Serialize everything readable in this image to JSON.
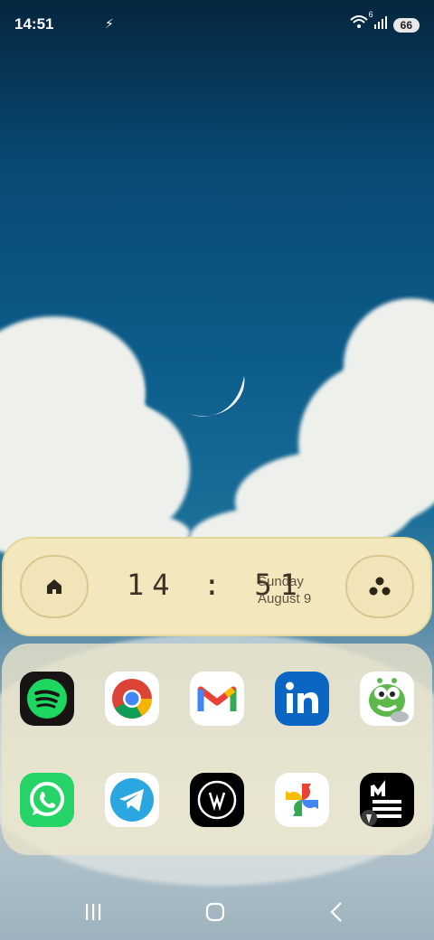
{
  "status_bar": {
    "time": "14:51",
    "signal_tag": "6",
    "battery": "66"
  },
  "icons": [
    "flash-icon",
    "wifi-icon",
    "signal-icon",
    "battery-icon"
  ],
  "widget": {
    "time": "14 : 51",
    "day": "Sunday",
    "date": "August 9"
  },
  "apps": [
    {
      "name": "Spotify"
    },
    {
      "name": "Chrome"
    },
    {
      "name": "Gmail"
    },
    {
      "name": "LinkedIn"
    },
    {
      "name": "Alien"
    },
    {
      "name": "WhatsApp"
    },
    {
      "name": "Telegram"
    },
    {
      "name": "Vinted"
    },
    {
      "name": "Google Photos"
    },
    {
      "name": "Medium"
    }
  ],
  "colors": {
    "widget_bg": "#f3e7bd",
    "sky": "#0c4a6e"
  }
}
